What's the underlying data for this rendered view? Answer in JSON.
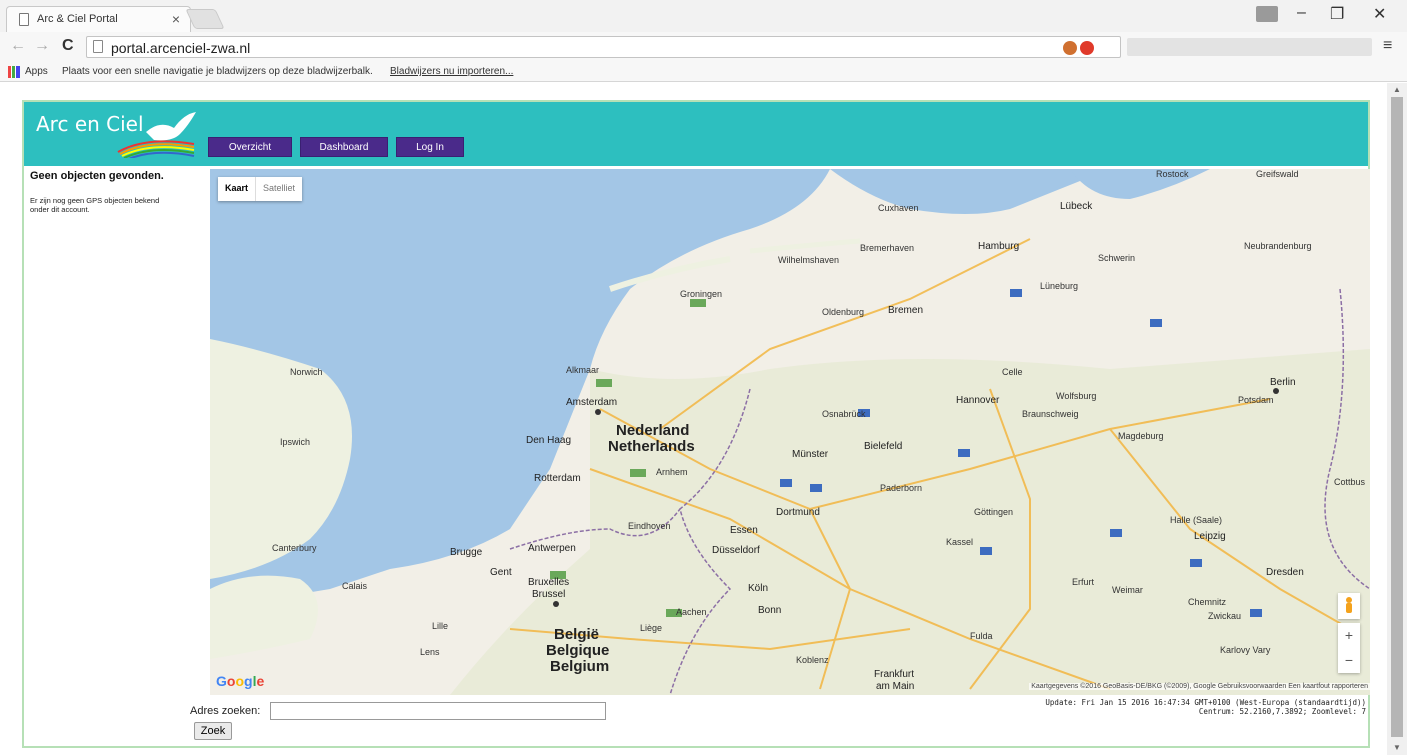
{
  "browser": {
    "tab_title": "Arc & Ciel Portal",
    "tab_close": "×",
    "url": "portal.arcenciel-zwa.nl",
    "window_controls": {
      "minimize": "–",
      "maximize": "❐",
      "close": "✕"
    },
    "nav": {
      "back": "←",
      "forward": "→",
      "reload": "C",
      "star": "☆",
      "menu": "≡"
    },
    "bookmarks": {
      "apps_label": "Apps",
      "hint": "Plaats voor een snelle navigatie je bladwijzers op deze bladwijzerbalk.",
      "import_link": "Bladwijzers nu importeren..."
    }
  },
  "header": {
    "logo_text": "Arc en Ciel",
    "logo_icon": "dove-rainbow-logo",
    "nav": [
      "Overzicht",
      "Dashboard",
      "Log In"
    ],
    "bg_color": "#2dbfbf",
    "button_color": "#4a2a8a"
  },
  "sidebar": {
    "title": "Geen objecten gevonden.",
    "text": "Er zijn nog geen GPS objecten bekend onder dit account."
  },
  "map": {
    "type_buttons": [
      "Kaart",
      "Satelliet"
    ],
    "active_type": "Kaart",
    "google_logo": "Google",
    "zoom_in": "+",
    "zoom_out": "−",
    "attribution": "Kaartgegevens ©2016 GeoBasis-DE/BKG (©2009), Google   Gebruiksvoorwaarden   Een kaartfout rapporteren",
    "labels": {
      "rostock": "Rostock",
      "greifswald": "Greifswald",
      "cuxhaven": "Cuxhaven",
      "lubeck": "Lübeck",
      "hamburg": "Hamburg",
      "schwerin": "Schwerin",
      "neubrandenburg": "Neubrandenburg",
      "wilhelmshaven": "Wilhelmshaven",
      "bremerhaven": "Bremerhaven",
      "groningen": "Groningen",
      "oldenburg": "Oldenburg",
      "bremen": "Bremen",
      "luneburg": "Lüneburg",
      "norwich": "Norwich",
      "alkmaar": "Alkmaar",
      "amsterdam": "Amsterdam",
      "nederland": "Nederland",
      "netherlands": "Netherlands",
      "den_haag": "Den Haag",
      "ipswich": "Ipswich",
      "osnabruck": "Osnabrück",
      "hannover": "Hannover",
      "wolfsburg": "Wolfsburg",
      "berlin": "Berlin",
      "potsdam": "Potsdam",
      "braunschweig": "Braunschweig",
      "magdeburg": "Magdeburg",
      "celle": "Celle",
      "bielefeld": "Bielefeld",
      "munster": "Münster",
      "rotterdam": "Rotterdam",
      "arnhem": "Arnhem",
      "paderborn": "Paderborn",
      "cottbus": "Cottbus",
      "dortmund": "Dortmund",
      "gottingen": "Göttingen",
      "halle": "Halle (Saale)",
      "leipzig": "Leipzig",
      "eindhoven": "Eindhoven",
      "essen": "Essen",
      "brugge": "Brugge",
      "antwerpen": "Antwerpen",
      "dusseldorf": "Düsseldorf",
      "canterbury": "Canterbury",
      "kassel": "Kassel",
      "gent": "Gent",
      "bruxelles": "Bruxelles",
      "brussel": "Brussel",
      "koln": "Köln",
      "calais": "Calais",
      "erfurt": "Erfurt",
      "weimar": "Weimar",
      "dresden": "Dresden",
      "bonn": "Bonn",
      "chemnitz": "Chemnitz",
      "aachen": "Aachen",
      "liege": "Liège",
      "lille": "Lille",
      "zwickau": "Zwickau",
      "belgie": "België",
      "belgique": "Belgique",
      "belgium": "Belgium",
      "fulda": "Fulda",
      "lens": "Lens",
      "koblenz": "Koblenz",
      "frankfurt": "Frankfurt",
      "frankfurt2": "am Main",
      "karlovy": "Karlovy Vary"
    }
  },
  "status": {
    "update": "Update: Fri Jan 15 2016 16:47:34 GMT+0100 (West-Europa (standaardtijd))",
    "centrum": "Centrum: 52.2160,7.3892; Zoomlevel: 7"
  },
  "search": {
    "label": "Adres zoeken:",
    "value": "",
    "button": "Zoek"
  }
}
